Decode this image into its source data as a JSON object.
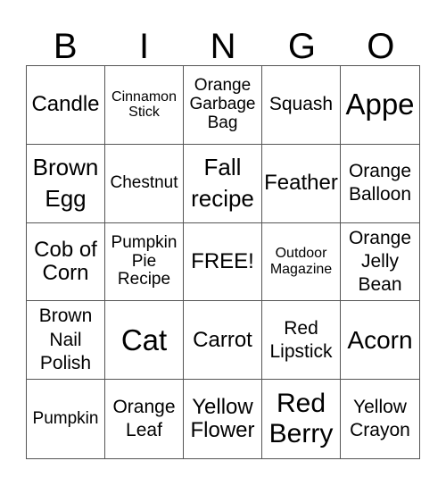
{
  "header": {
    "letters": [
      "B",
      "I",
      "N",
      "G",
      "O"
    ]
  },
  "cells": [
    "Candle",
    "Cinnamon\nStick",
    "Orange\nGarbage\nBag",
    "Squash",
    "Appe",
    "Brown\nEgg",
    "Chestnut",
    "Fall\nrecipe",
    "Feather",
    "Orange\nBalloon",
    "Cob of\nCorn",
    "Pumpkin\nPie\nRecipe",
    "FREE!",
    "Outdoor\nMagazine",
    "Orange\nJelly\nBean",
    "Brown\nNail\nPolish",
    "Cat",
    "Carrot",
    "Red\nLipstick",
    "Acorn",
    "Pumpkin",
    "Orange\nLeaf",
    "Yellow\nFlower",
    "Red\nBerry",
    "Yellow\nCrayon"
  ]
}
